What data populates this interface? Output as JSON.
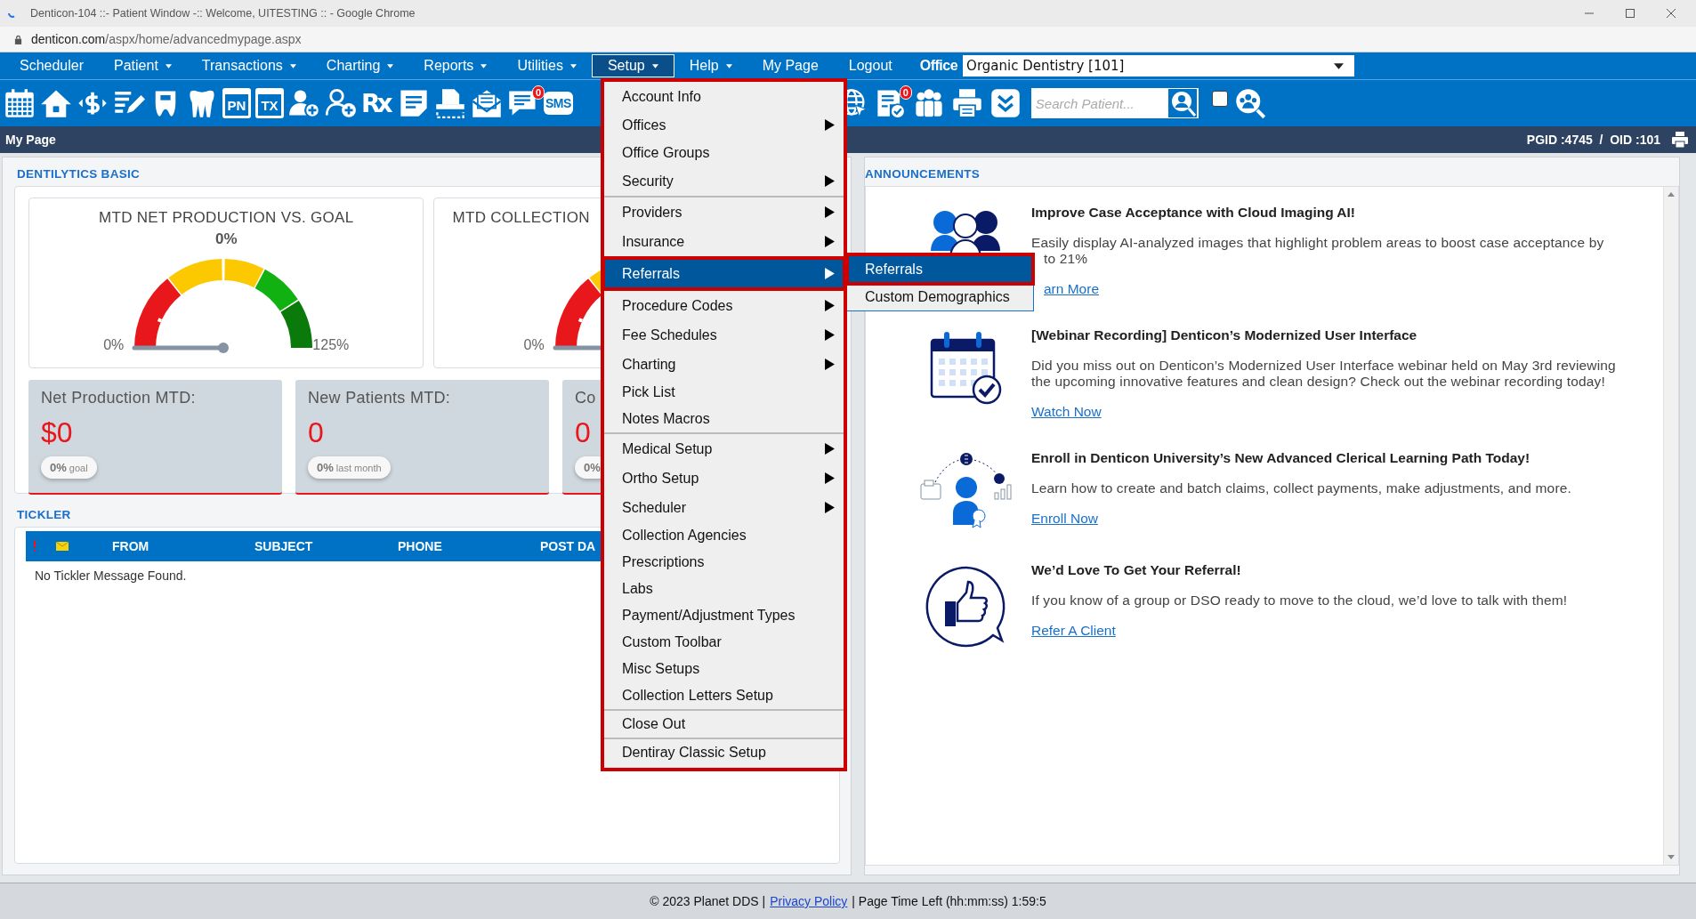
{
  "window": {
    "title": "Denticon-104 ::- Patient Window -:: Welcome, UITESTING :: - Google Chrome"
  },
  "address_bar": {
    "host": "denticon.com",
    "path": "/aspx/home/advancedmypage.aspx"
  },
  "nav": {
    "items": [
      {
        "label": "Scheduler",
        "has_dropdown": false,
        "selected": false
      },
      {
        "label": "Patient",
        "has_dropdown": true,
        "selected": false
      },
      {
        "label": "Transactions",
        "has_dropdown": true,
        "selected": false
      },
      {
        "label": "Charting",
        "has_dropdown": true,
        "selected": false
      },
      {
        "label": "Reports",
        "has_dropdown": true,
        "selected": false
      },
      {
        "label": "Utilities",
        "has_dropdown": true,
        "selected": false
      },
      {
        "label": "Setup",
        "has_dropdown": true,
        "selected": true
      },
      {
        "label": "Help",
        "has_dropdown": true,
        "selected": false
      },
      {
        "label": "My Page",
        "has_dropdown": false,
        "selected": false
      },
      {
        "label": "Logout",
        "has_dropdown": false,
        "selected": false
      }
    ],
    "office_label": "Office",
    "office_value": "Organic Dentistry [101]"
  },
  "toolbar": {
    "pn_label": "PN",
    "tx_label": "TX",
    "rx_label": "Rx",
    "sms_label": "SMS",
    "messages_badge": "0",
    "tasks_badge": "0",
    "search_placeholder": "Search Patient...",
    "checkbox_checked": false
  },
  "page_bar": {
    "title": "My Page",
    "ids": "PGID :4745  /  OID :101"
  },
  "dentilytics": {
    "heading": "DENTILYTICS BASIC",
    "gauges": [
      {
        "title": "MTD NET PRODUCTION VS. GOAL",
        "reading": "0%",
        "min_label": "0%",
        "max_label": "125%",
        "level": 0
      },
      {
        "title": "MTD COLLECTION",
        "min_label": "0%",
        "level": 0
      }
    ],
    "stats": [
      {
        "label": "Net Production MTD:",
        "value": "$0",
        "pill": "**0%** goal"
      },
      {
        "label": "New Patients MTD:",
        "value": "0",
        "pill": "**0%** last month"
      },
      {
        "label": "Co",
        "value": "0",
        "pill": "**0%**"
      }
    ]
  },
  "tickler": {
    "heading": "TICKLER",
    "columns": [
      "FROM",
      "SUBJECT",
      "PHONE",
      "POST DA"
    ],
    "empty_message": "No Tickler Message Found."
  },
  "announcements": {
    "heading": "ANNOUNCEMENTS",
    "items": [
      {
        "kind": "people",
        "title": "Improve Case Acceptance with Cloud Imaging AI!",
        "lines": [
          "Easily display AI-analyzed images that highlight problem areas to boost case acceptance by",
          "to 21%"
        ],
        "link": "arn More",
        "partly_covered": true
      },
      {
        "kind": "calendar",
        "title": "[Webinar Recording] Denticon’s Modernized User Interface",
        "lines": [
          "Did you miss out on Denticon’s Modernized User Interface webinar held on May 3rd reviewing",
          "the upcoming innovative features and clean design? Check out the webinar recording today!"
        ],
        "link": "Watch Now",
        "partly_covered": false
      },
      {
        "kind": "learning",
        "title": "Enroll in Denticon University’s New Advanced Clerical Learning Path Today!",
        "lines": [
          "Learn how to create and batch claims, collect payments, make adjustments, and more."
        ],
        "link": "Enroll Now",
        "partly_covered": false
      },
      {
        "kind": "thumbs",
        "title": "We’d Love To Get Your Referral!",
        "lines": [
          "If you know of a group or DSO ready to move to the cloud, we’d love to talk with them!"
        ],
        "link": "Refer A Client",
        "partly_covered": false
      }
    ]
  },
  "setup_menu": {
    "annotated": true,
    "groups": [
      [
        {
          "label": "Account Info",
          "has_submenu": false,
          "selected": false
        },
        {
          "label": "Offices",
          "has_submenu": true,
          "selected": false
        },
        {
          "label": "Office Groups",
          "has_submenu": false,
          "selected": false
        },
        {
          "label": "Security",
          "has_submenu": true,
          "selected": false
        }
      ],
      [
        {
          "label": "Providers",
          "has_submenu": true,
          "selected": false
        },
        {
          "label": "Insurance",
          "has_submenu": true,
          "selected": false
        },
        {
          "label": "Referrals",
          "has_submenu": true,
          "selected": true
        },
        {
          "label": "Procedure Codes",
          "has_submenu": true,
          "selected": false
        },
        {
          "label": "Fee Schedules",
          "has_submenu": true,
          "selected": false
        },
        {
          "label": "Charting",
          "has_submenu": true,
          "selected": false
        },
        {
          "label": "Pick List",
          "has_submenu": false,
          "selected": false
        },
        {
          "label": "Notes Macros",
          "has_submenu": false,
          "selected": false
        }
      ],
      [
        {
          "label": "Medical Setup",
          "has_submenu": true,
          "selected": false
        },
        {
          "label": "Ortho Setup",
          "has_submenu": true,
          "selected": false
        },
        {
          "label": "Scheduler",
          "has_submenu": true,
          "selected": false
        },
        {
          "label": "Collection Agencies",
          "has_submenu": false,
          "selected": false
        },
        {
          "label": "Prescriptions",
          "has_submenu": false,
          "selected": false
        },
        {
          "label": "Labs",
          "has_submenu": false,
          "selected": false
        },
        {
          "label": "Payment/Adjustment Types",
          "has_submenu": false,
          "selected": false
        },
        {
          "label": "Custom Toolbar",
          "has_submenu": false,
          "selected": false
        },
        {
          "label": "Misc Setups",
          "has_submenu": false,
          "selected": false
        },
        {
          "label": "Collection Letters Setup",
          "has_submenu": false,
          "selected": false
        }
      ],
      [
        {
          "label": "Close Out",
          "has_submenu": false,
          "selected": false
        }
      ],
      [
        {
          "label": "Dentiray Classic Setup",
          "has_submenu": false,
          "selected": false
        }
      ]
    ],
    "submenu": [
      {
        "label": "Referrals",
        "selected": true
      },
      {
        "label": "Custom Demographics",
        "selected": false
      }
    ]
  },
  "footer": {
    "copyright": "© 2023 Planet DDS |",
    "link": "Privacy Policy",
    "time_left": "| Page Time Left (hh:mm:ss) 1:59:5"
  }
}
